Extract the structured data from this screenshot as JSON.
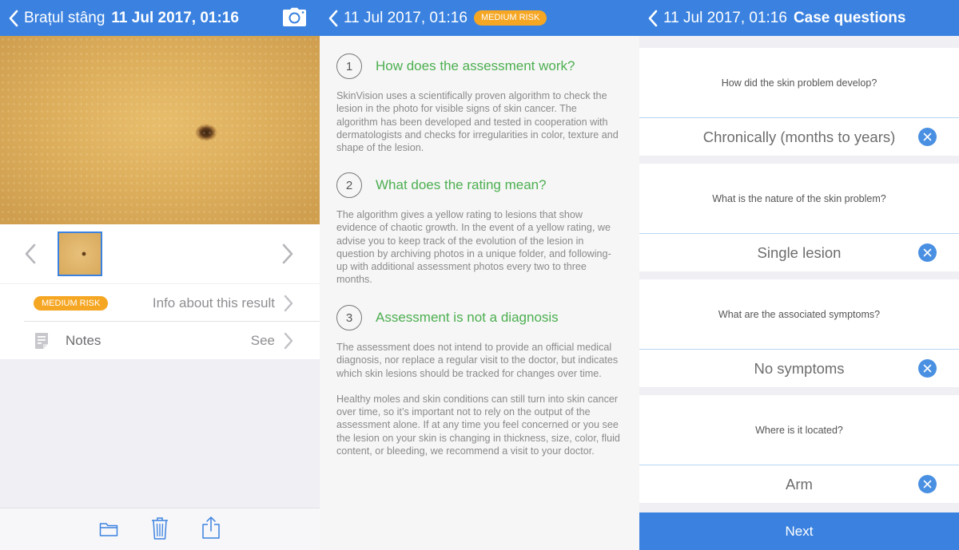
{
  "colors": {
    "nav_blue": "#3b82e0",
    "risk_orange": "#f5a623",
    "heading_green": "#4caf50",
    "clear_blue": "#4a90e2"
  },
  "panel1": {
    "nav": {
      "back_label": "Brațul stâng",
      "timestamp": "11 Jul 2017, 01:16",
      "camera_icon": "camera-icon"
    },
    "result_row": {
      "badge": "MEDIUM RISK",
      "label": "Info about this result"
    },
    "notes_row": {
      "label": "Notes",
      "action": "See"
    },
    "toolbar": {
      "icons": [
        "folder-icon",
        "trash-icon",
        "share-icon"
      ]
    }
  },
  "panel2": {
    "nav": {
      "timestamp": "11 Jul 2017, 01:16",
      "badge": "MEDIUM RISK"
    },
    "sections": [
      {
        "number": "1",
        "title": "How does the assessment work?",
        "paragraphs": [
          "SkinVision uses a scientifically proven algorithm to check the lesion in the photo for visible signs of skin cancer. The algorithm has been developed and tested in cooperation with dermatologists and checks for irregularities in color, texture and shape of the lesion."
        ]
      },
      {
        "number": "2",
        "title": "What does the rating mean?",
        "paragraphs": [
          "The algorithm gives a yellow rating to lesions that show evidence of chaotic growth. In the event of a yellow rating, we advise you to keep track of the evolution of the lesion in question by archiving photos in a unique folder, and following-up with additional assessment photos every two to three months."
        ]
      },
      {
        "number": "3",
        "title": "Assessment is not a diagnosis",
        "paragraphs": [
          "The assessment does not intend to provide an official medical diagnosis, nor replace a regular visit to the doctor, but indicates which skin lesions should be tracked for changes over time.",
          "Healthy moles and skin conditions can still turn into skin cancer over time, so it’s important not to rely on the output of the assessment alone. If at any time you feel concerned or you see the lesion on your skin is changing in thickness, size, color, fluid content, or bleeding, we recommend a visit to your doctor."
        ]
      }
    ]
  },
  "panel3": {
    "nav": {
      "timestamp": "11 Jul 2017, 01:16",
      "title": "Case questions"
    },
    "questions": [
      {
        "question": "How did the skin problem develop?",
        "answer": "Chronically (months to years)"
      },
      {
        "question": "What is the nature of the skin problem?",
        "answer": "Single lesion"
      },
      {
        "question": "What are the associated symptoms?",
        "answer": "No symptoms"
      },
      {
        "question": "Where is it located?",
        "answer": "Arm"
      }
    ],
    "next_label": "Next"
  }
}
